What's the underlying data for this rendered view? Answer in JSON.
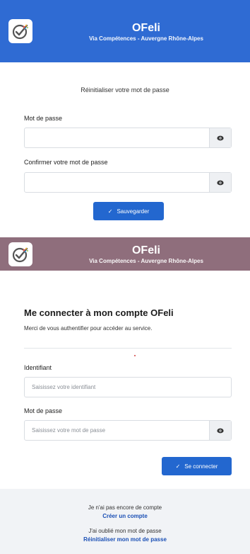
{
  "app": {
    "name": "OFeli",
    "subtitle": "Via Compétences - Auvergne Rhône-Alpes",
    "logo_icon": "check-circle-icon",
    "header_color_reset": "#2f6bd3",
    "header_color_login": "#8f6e7c",
    "accent": "#2367cf"
  },
  "reset": {
    "heading": "Réinitialiser votre mot de passe",
    "password_label": "Mot de passe",
    "password_value": "",
    "confirm_label": "Confirmer votre mot de passe",
    "confirm_value": "",
    "show_icon": "eye-icon",
    "save_label": "Sauvegarder"
  },
  "login": {
    "title": "Me connecter à mon compte OFeli",
    "intro": "Merci de vous authentifier pour accéder au service.",
    "id_label": "Identifiant",
    "id_placeholder": "Saisissez votre identifiant",
    "pw_label": "Mot de passe",
    "pw_placeholder": "Saisissez votre mot de passe",
    "show_icon": "eye-icon",
    "submit_label": "Se connecter"
  },
  "footer": {
    "no_account": "Je n'ai pas encore de compte",
    "create_link": "Créer un compte",
    "forgot": "J'ai oublié mon mot de passe",
    "reset_link": "Réinitialiser mon mot de passe"
  }
}
